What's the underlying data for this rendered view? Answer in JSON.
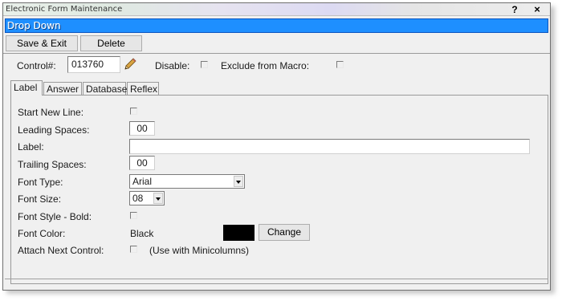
{
  "window": {
    "title": "Electronic Form Maintenance",
    "help_label": "?",
    "close_label": "×",
    "header_title": "Drop Down",
    "header_color": "#1e8fff"
  },
  "toolbar": {
    "save_label": "Save & Exit",
    "delete_label": "Delete"
  },
  "control": {
    "label": "Control#:",
    "value": "013760",
    "edit_icon": "pencil-icon",
    "disable_label": "Disable:",
    "disable_checked": false,
    "exclude_label": "Exclude from Macro:",
    "exclude_checked": false
  },
  "tabs": [
    {
      "label": "Label",
      "active": true
    },
    {
      "label": "Answer",
      "active": false
    },
    {
      "label": "Database",
      "active": false
    },
    {
      "label": "Reflex",
      "active": false
    }
  ],
  "form": {
    "start_new_line_label": "Start New Line:",
    "start_new_line_checked": false,
    "leading_spaces_label": "Leading Spaces:",
    "leading_spaces_value": "00",
    "label_label": "Label:",
    "label_value": "",
    "trailing_spaces_label": "Trailing Spaces:",
    "trailing_spaces_value": "00",
    "font_type_label": "Font Type:",
    "font_type_value": "Arial",
    "font_size_label": "Font Size:",
    "font_size_value": "08",
    "font_bold_label": "Font Style - Bold:",
    "font_bold_checked": false,
    "font_color_label": "Font Color:",
    "font_color_value": "Black",
    "font_color_swatch": "#000000",
    "change_label": "Change",
    "attach_label": "Attach Next Control:",
    "attach_checked": false,
    "attach_note": "(Use with Minicolumns)"
  }
}
